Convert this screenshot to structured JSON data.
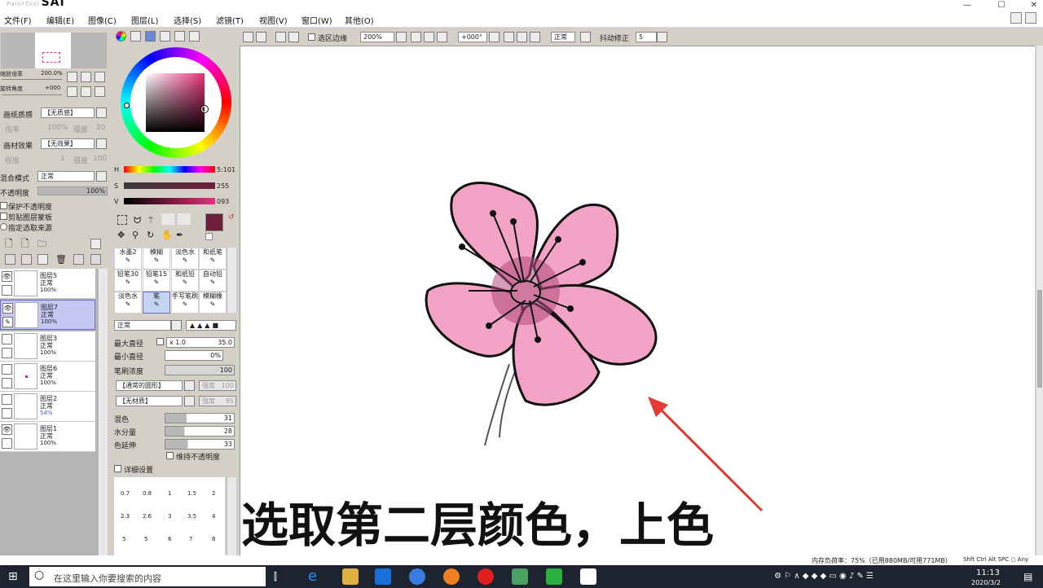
{
  "app": {
    "logo": "SAI",
    "logo_sub": "PaintTool",
    "minimize": "—",
    "maximize": "☐",
    "close": "✕"
  },
  "menu": [
    {
      "label": "文件(F)"
    },
    {
      "label": "编辑(E)"
    },
    {
      "label": "图像(C)"
    },
    {
      "label": "图层(L)"
    },
    {
      "label": "选择(S)"
    },
    {
      "label": "滤镜(T)"
    },
    {
      "label": "视图(V)"
    },
    {
      "label": "窗口(W)"
    },
    {
      "label": "其他(O)"
    }
  ],
  "toolbar": {
    "selection_edge_label": "选区边缘",
    "zoom": "200%",
    "angle": "+000°",
    "mode": "正常",
    "stabilizer_label": "抖动修正",
    "stabilizer": "5"
  },
  "navigator": {
    "zoom_label": "缩放倍率",
    "zoom_value": "200.0%",
    "rotate_label": "旋转角度",
    "rotate_value": "+000"
  },
  "paper": {
    "texture_label": "画纸质感",
    "texture_value": "【无质感】",
    "scale_label": "倍率",
    "scale_value": "100%",
    "strength_label": "强度",
    "strength_value": "20",
    "effect_label": "画材效果",
    "effect_value": "【无效果】",
    "degree_label": "程度",
    "degree_value": "1",
    "intensity_label": "强度",
    "intensity_value": "100"
  },
  "layer_props": {
    "blend_label": "混合模式",
    "blend_value": "正常",
    "opacity_label": "不透明度",
    "opacity_value": "100%",
    "opacity_level": 1.0,
    "protect_opacity": "保护不透明度",
    "clip_group": "剪贴图层蒙板",
    "selection_source": "指定选取来源"
  },
  "layers": [
    {
      "name": "图层5",
      "mode": "正常",
      "opacity": "100%",
      "visible": true
    },
    {
      "name": "图层7",
      "mode": "正常",
      "opacity": "100%",
      "visible": true,
      "selected": true
    },
    {
      "name": "图层3",
      "mode": "正常",
      "opacity": "100%",
      "visible": false
    },
    {
      "name": "图层6",
      "mode": "正常",
      "opacity": "100%",
      "visible": false
    },
    {
      "name": "图层2",
      "mode": "正常",
      "opacity": "54%",
      "visible": false
    },
    {
      "name": "图层1",
      "mode": "正常",
      "opacity": "100%",
      "visible": true
    }
  ],
  "color": {
    "h_label": "H",
    "h_value": "5:101",
    "s_label": "S",
    "s_value": "255",
    "v_label": "V",
    "v_value": "093",
    "current": "#6b1f3a"
  },
  "brushes": [
    {
      "label": "水墨2"
    },
    {
      "label": "模糊"
    },
    {
      "label": "淡色水"
    },
    {
      "label": "和纸笔"
    },
    {
      "label": "铅笔30"
    },
    {
      "label": "铅笔15"
    },
    {
      "label": "和纸铅"
    },
    {
      "label": "自动铅"
    },
    {
      "label": "淡色水"
    },
    {
      "label": "笔",
      "selected": true
    },
    {
      "label": "手写笔刷"
    },
    {
      "label": "模糊橡"
    }
  ],
  "tool_settings": {
    "mode": "正常",
    "max_size_label": "最大直径",
    "max_size_mult": "x 1.0",
    "max_size_value": "35.0",
    "min_size_label": "最小直径",
    "min_size_value": "0%",
    "density_label": "笔刷浓度",
    "density_value": "100",
    "shape_value": "【通常的圆形】",
    "shape_strength": "强度",
    "shape_strength_value": "100",
    "texture_value": "【无材质】",
    "texture_strength": "强度",
    "texture_strength_value": "95",
    "blend_label": "混色",
    "blend_value": "31",
    "water_label": "水分量",
    "water_value": "28",
    "persistence_label": "色延伸",
    "persistence_value": "33",
    "keep_opacity": "维持不透明度",
    "detail": "详细设置"
  },
  "brush_sizes": [
    "0.7",
    "0.8",
    "1",
    "1.5",
    "2",
    "2.3",
    "2.6",
    "3",
    "3.5",
    "4",
    "5",
    "5",
    "6",
    "7",
    "8"
  ],
  "caption": "选取第二层颜色，上色",
  "status": {
    "memory": "内存负荷率：75%（已用880MB/可用771MB）",
    "keys": "Shft Ctrl Alt SPC ○ Any"
  },
  "taskbar": {
    "search_placeholder": "在这里输入你要搜索的内容",
    "time": "11:13",
    "date": "2020/3/2"
  }
}
